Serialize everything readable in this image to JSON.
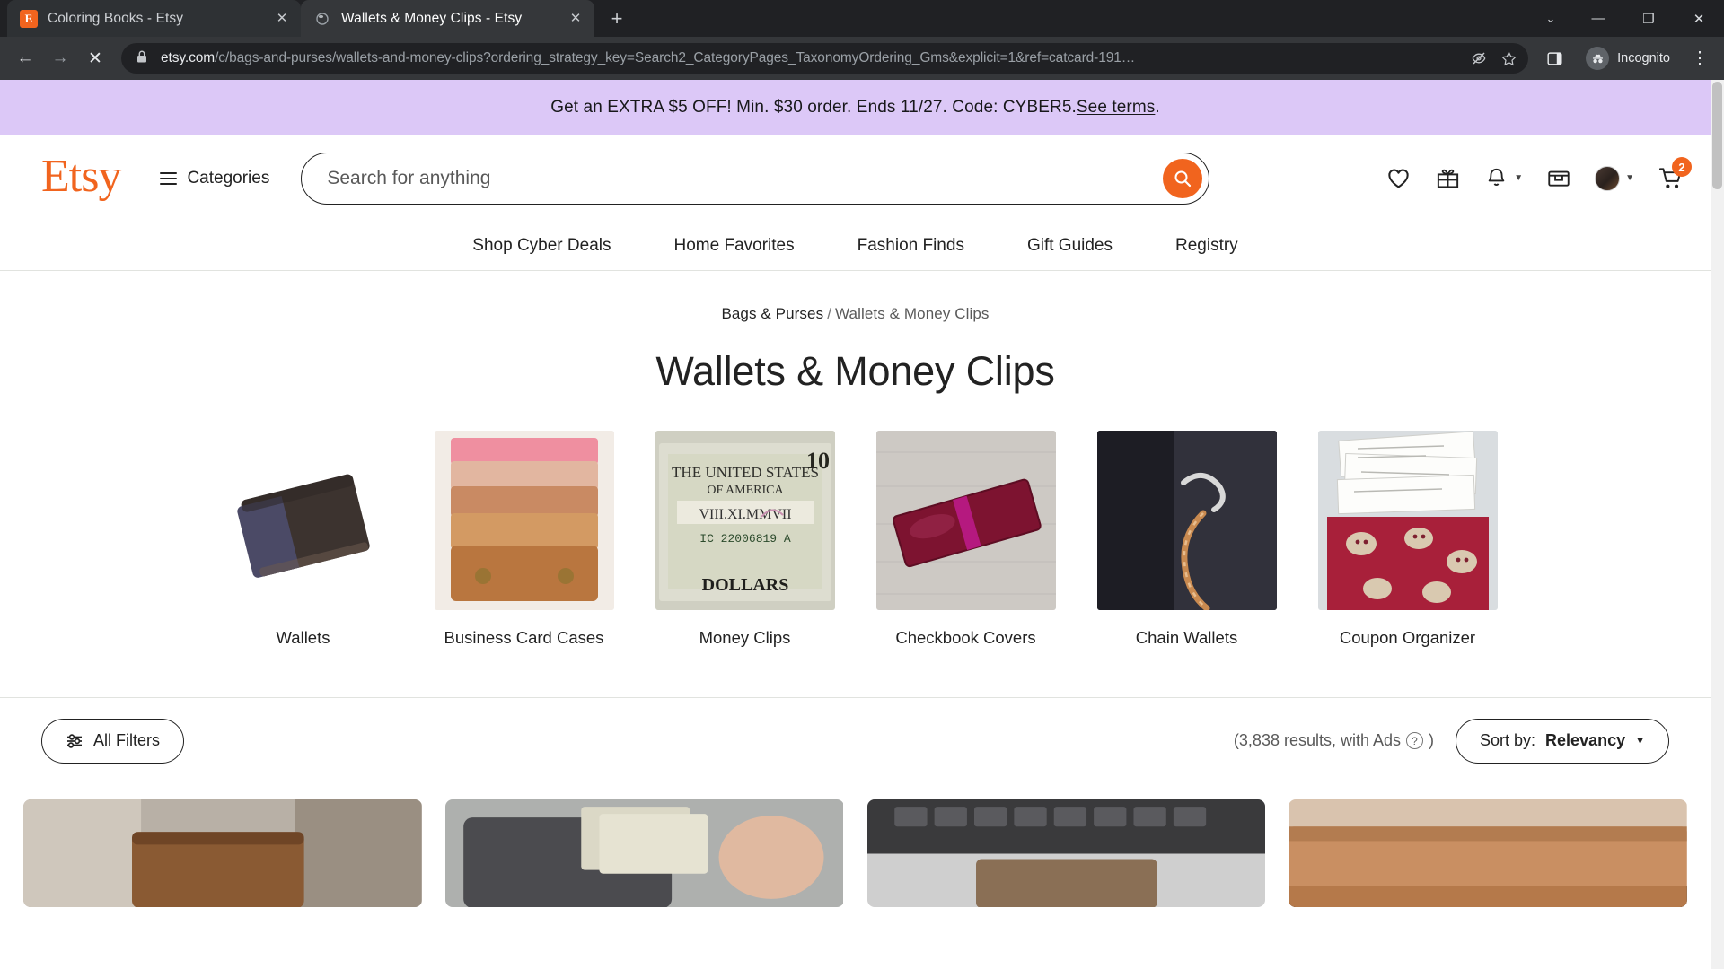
{
  "browser": {
    "tabs": [
      {
        "title": "Coloring Books - Etsy",
        "favicon": "etsy-favicon",
        "active": false,
        "close_label": "✕"
      },
      {
        "title": "Wallets & Money Clips - Etsy",
        "favicon": "page-favicon",
        "active": true,
        "close_label": "✕"
      }
    ],
    "new_tab_label": "+",
    "window_controls": {
      "chevron": "⌄",
      "minimize": "—",
      "maximize": "❐",
      "close": "✕"
    },
    "nav": {
      "back": "←",
      "forward": "→",
      "stop": "✕"
    },
    "omnibox": {
      "domain": "etsy.com",
      "path": "/c/bags-and-purses/wallets-and-money-clips?ordering_strategy_key=Search2_CategoryPages_TaxonomyOrdering_Gms&explicit=1&ref=catcard-191…"
    },
    "profile_label": "Incognito",
    "menu_label": "⋮"
  },
  "promo": {
    "text": "Get an EXTRA $5 OFF! Min. $30 order. Ends 11/27. Code: CYBER5. ",
    "link_text": "See terms",
    "tail": ".",
    "background": "#dcc8f7"
  },
  "header": {
    "logo": "Etsy",
    "logo_color": "#f1641e",
    "categories_label": "Categories",
    "search": {
      "placeholder": "Search for anything",
      "value": ""
    },
    "cart_count": "2",
    "icons": [
      "heart-icon",
      "gift-icon",
      "bell-icon",
      "mail-icon",
      "account-icon",
      "cart-icon"
    ]
  },
  "subnav": {
    "items": [
      {
        "label": "Shop Cyber Deals"
      },
      {
        "label": "Home Favorites"
      },
      {
        "label": "Fashion Finds"
      },
      {
        "label": "Gift Guides"
      },
      {
        "label": "Registry"
      }
    ]
  },
  "main": {
    "breadcrumb": {
      "parent": "Bags & Purses",
      "separator": "/",
      "current": "Wallets & Money Clips"
    },
    "title": "Wallets & Money Clips",
    "categories": [
      {
        "label": "Wallets",
        "art": "wallet"
      },
      {
        "label": "Business Card Cases",
        "art": "cardcase"
      },
      {
        "label": "Money Clips",
        "art": "moneyclip"
      },
      {
        "label": "Checkbook Covers",
        "art": "checkbook"
      },
      {
        "label": "Chain Wallets",
        "art": "chainwallet"
      },
      {
        "label": "Coupon Organizer",
        "art": "coupon"
      }
    ]
  },
  "filterbar": {
    "all_filters_label": "All Filters",
    "results_prefix": "(3,838 results, with Ads",
    "results_suffix": ")",
    "help_glyph": "?",
    "sort_prefix": "Sort by: ",
    "sort_value": "Relevancy",
    "sort_caret": "▼"
  },
  "results": [
    {
      "art": "res1"
    },
    {
      "art": "res2"
    },
    {
      "art": "res3"
    },
    {
      "art": "res4"
    }
  ]
}
